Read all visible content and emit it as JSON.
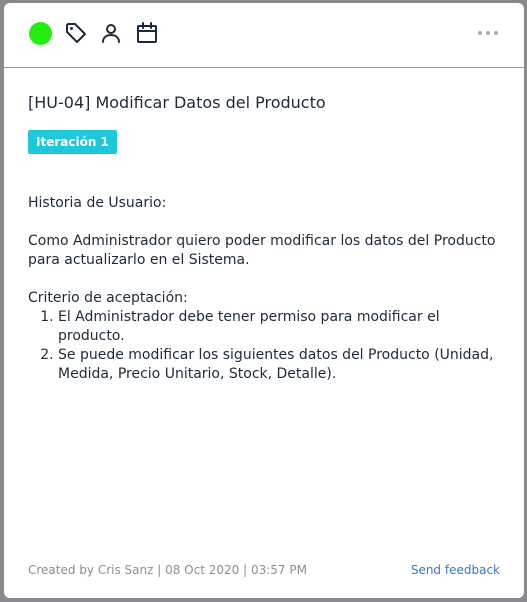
{
  "card": {
    "status_color": "#22ee11",
    "toolbar_icons": [
      "tag-icon",
      "person-icon",
      "calendar-icon"
    ],
    "menu_icon": "more-horizontal-icon",
    "title": "[HU-04] Modificar Datos del Producto",
    "tag": {
      "label": "Iteración 1",
      "color": "#1ec8d8"
    },
    "description": {
      "heading": "Historia de Usuario:",
      "story": "Como Administrador quiero poder modificar los datos del Producto para actualizarlo en el Sistema.",
      "criteria_heading": "Criterio de aceptación:",
      "criteria": [
        "El Administrador debe tener permiso para modificar el producto.",
        "Se puede modificar los siguientes datos del Producto (Unidad, Medida, Precio Unitario, Stock, Detalle)."
      ]
    },
    "footer": {
      "meta": "Created by Cris Sanz | 08 Oct 2020 | 03:57 PM",
      "feedback_label": "Send feedback"
    }
  }
}
